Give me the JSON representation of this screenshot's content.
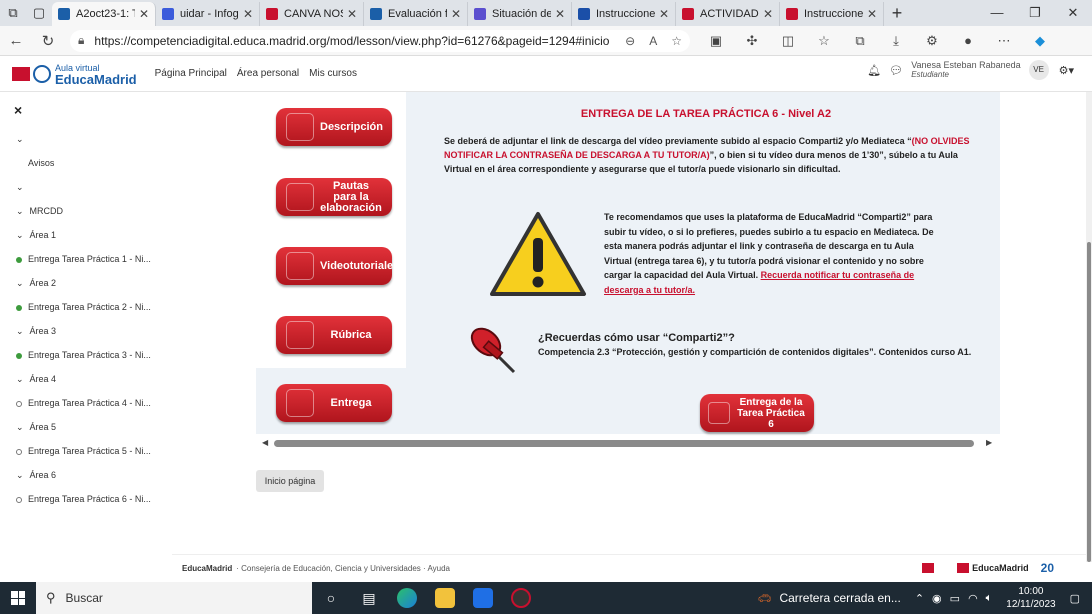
{
  "tabs": [
    {
      "label": "A2oct23-1: T",
      "active": true,
      "color": "#1b5fa8"
    },
    {
      "label": "uidar - Infog",
      "active": false,
      "color": "#3b5bdb"
    },
    {
      "label": "CANVA NOS",
      "active": false,
      "color": "#c8102e"
    },
    {
      "label": "Evaluación fi",
      "active": false,
      "color": "#1b5fa8"
    },
    {
      "label": "Situación de",
      "active": false,
      "color": "#5b4fcf"
    },
    {
      "label": "Instrucciones",
      "active": false,
      "color": "#1b4fa8"
    },
    {
      "label": "ACTIVIDAD",
      "active": false,
      "color": "#c8102e"
    },
    {
      "label": "Instrucciones",
      "active": false,
      "color": "#c8102e"
    }
  ],
  "browser": {
    "url": "https://competenciadigital.educa.madrid.org/mod/lesson/view.php?id=61276&pageid=1294#inicio"
  },
  "site": {
    "logo_sub": "Aula virtual",
    "logo_main": "EducaMadrid",
    "nav": [
      "Página Principal",
      "Área personal",
      "Mis cursos"
    ],
    "user_name": "Vanesa Esteban Rabaneda",
    "user_role": "Estudiante",
    "user_initials": "VE"
  },
  "sidebar": {
    "close": "×",
    "items": [
      {
        "label": "",
        "type": "chev"
      },
      {
        "label": "Avisos",
        "type": "plain"
      },
      {
        "label": "",
        "type": "chev"
      },
      {
        "label": "MRCDD",
        "type": "section"
      },
      {
        "label": "Área 1",
        "type": "section"
      },
      {
        "label": "Entrega Tarea Práctica 1 - Ni...",
        "type": "done"
      },
      {
        "label": "Área 2",
        "type": "section"
      },
      {
        "label": "Entrega Tarea Práctica 2 - Ni...",
        "type": "done"
      },
      {
        "label": "Área 3",
        "type": "section"
      },
      {
        "label": "Entrega Tarea Práctica 3 - Ni...",
        "type": "done"
      },
      {
        "label": "Área 4",
        "type": "section"
      },
      {
        "label": "Entrega Tarea Práctica 4 - Ni...",
        "type": "todo"
      },
      {
        "label": "Área 5",
        "type": "section"
      },
      {
        "label": "Entrega Tarea Práctica 5 - Ni...",
        "type": "todo"
      },
      {
        "label": "Área 6",
        "type": "section"
      },
      {
        "label": "Entrega Tarea Práctica 6 - Ni...",
        "type": "todo"
      }
    ]
  },
  "lesson": {
    "buttons": [
      "Descripción",
      "Pautas para la elaboración",
      "Videotutoriales",
      "Rúbrica",
      "Entrega"
    ],
    "title": "ENTREGA DE LA TAREA PRÁCTICA 6 - Nivel A2",
    "p1_a": "Se deberá de adjuntar el link de descarga del vídeo previamente subido al espacio Comparti2 y/o Mediateca “",
    "p1_red": "(NO OLVIDES NOTIFICAR LA CONTRASEÑA DE DESCARGA A TU TUTOR/A)",
    "p1_b": "”, o bien si tu vídeo dura menos de 1’30”, súbelo a tu Aula Virtual en el área correspondiente y asegurarse que el tutor/a puede visionarlo sin dificultad.",
    "p2_a": "Te recomendamos que uses la plataforma de EducaMadrid “Comparti2” para subir tu vídeo, o si lo prefieres, puedes subirlo a tu espacio en Mediateca. De esta manera podrás adjuntar el link y contraseña de descarga en tu Aula Virtual (entrega tarea 6), y tu tutor/a podrá visionar el contenido y no sobre cargar la capacidad del Aula Virtual. ",
    "p2_link": "Recuerda notificar tu contraseña de descarga a tu tutor/a.",
    "q_title": "¿Recuerdas cómo usar “Comparti2”?",
    "q_text": "Competencia 2.3 “Protección, gestión y compartición de contenidos digitales”. Contenidos curso A1.",
    "tarea_btn": "Entrega de la Tarea Práctica 6",
    "inicio": "Inicio página"
  },
  "footer": {
    "brand": "EducaMadrid",
    "text": "· Consejería de Educación, Ciencia y Universidades · Ayuda",
    "logo": "EducaMadrid",
    "badge": "20"
  },
  "taskbar": {
    "search": "Buscar",
    "weather": "Carretera cerrada en...",
    "time": "10:00",
    "date": "12/11/2023"
  }
}
